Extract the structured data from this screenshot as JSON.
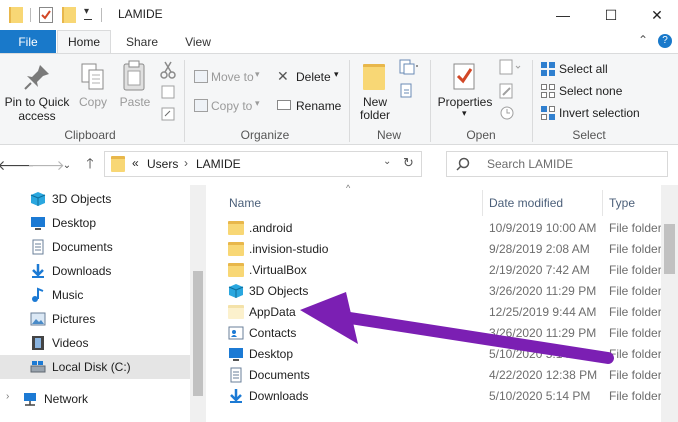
{
  "window": {
    "title": "LAMIDE",
    "controls": {
      "minimize": "—",
      "maximize": "☐",
      "close": "✕"
    }
  },
  "tabs": [
    {
      "label": "File"
    },
    {
      "label": "Home"
    },
    {
      "label": "Share"
    },
    {
      "label": "View"
    }
  ],
  "ribbon": {
    "help_glyph": "?",
    "collapse_glyph": "⌃",
    "clipboard": {
      "label": "Clipboard",
      "pin_to_quick_access": [
        "Pin to Quick",
        "access"
      ],
      "copy": "Copy",
      "paste": "Paste"
    },
    "organize": {
      "label": "Organize",
      "move_to": "Move to",
      "copy_to": "Copy to",
      "delete": "Delete",
      "rename": "Rename"
    },
    "new": {
      "label": "New",
      "new_folder": [
        "New",
        "folder"
      ]
    },
    "open": {
      "label": "Open",
      "properties": "Properties"
    },
    "select": {
      "label": "Select",
      "select_all": "Select all",
      "select_none": "Select none",
      "invert_selection": "Invert selection"
    }
  },
  "address": {
    "overflow": "«",
    "crumbs": [
      "Users",
      "LAMIDE"
    ],
    "search_placeholder": "Search LAMIDE"
  },
  "nav": [
    {
      "label": "3D Objects",
      "icon": "3d-objects-icon"
    },
    {
      "label": "Desktop",
      "icon": "desktop-icon"
    },
    {
      "label": "Documents",
      "icon": "documents-icon"
    },
    {
      "label": "Downloads",
      "icon": "downloads-icon"
    },
    {
      "label": "Music",
      "icon": "music-icon"
    },
    {
      "label": "Pictures",
      "icon": "pictures-icon"
    },
    {
      "label": "Videos",
      "icon": "videos-icon"
    },
    {
      "label": "Local Disk (C:)",
      "icon": "drive-icon"
    },
    {
      "label": "Network",
      "icon": "network-icon"
    }
  ],
  "columns": {
    "name": "Name",
    "date": "Date modified",
    "type": "Type"
  },
  "files": [
    {
      "name": ".android",
      "date": "10/9/2019 10:00 AM",
      "type": "File folder",
      "icon": "folder-icon"
    },
    {
      "name": ".invision-studio",
      "date": "9/28/2019 2:08 AM",
      "type": "File folder",
      "icon": "folder-icon"
    },
    {
      "name": ".VirtualBox",
      "date": "2/19/2020 7:42 AM",
      "type": "File folder",
      "icon": "folder-icon"
    },
    {
      "name": "3D Objects",
      "date": "3/26/2020 11:29 PM",
      "type": "File folder",
      "icon": "3d-objects-icon"
    },
    {
      "name": "AppData",
      "date": "12/25/2019 9:44 AM",
      "type": "File folder",
      "icon": "hidden-folder-icon"
    },
    {
      "name": "Contacts",
      "date": "3/26/2020 11:29 PM",
      "type": "File folder",
      "icon": "contacts-icon"
    },
    {
      "name": "Desktop",
      "date": "5/10/2020 5:14 PM",
      "type": "File folder",
      "icon": "desktop-icon"
    },
    {
      "name": "Documents",
      "date": "4/22/2020 12:38 PM",
      "type": "File folder",
      "icon": "documents-icon"
    },
    {
      "name": "Downloads",
      "date": "5/10/2020 5:14 PM",
      "type": "File folder",
      "icon": "downloads-icon"
    }
  ],
  "colors": {
    "accent": "#1979ca",
    "arrow": "#7b1fb3",
    "folder": "#f8d775",
    "selection": "#cce8ff"
  }
}
